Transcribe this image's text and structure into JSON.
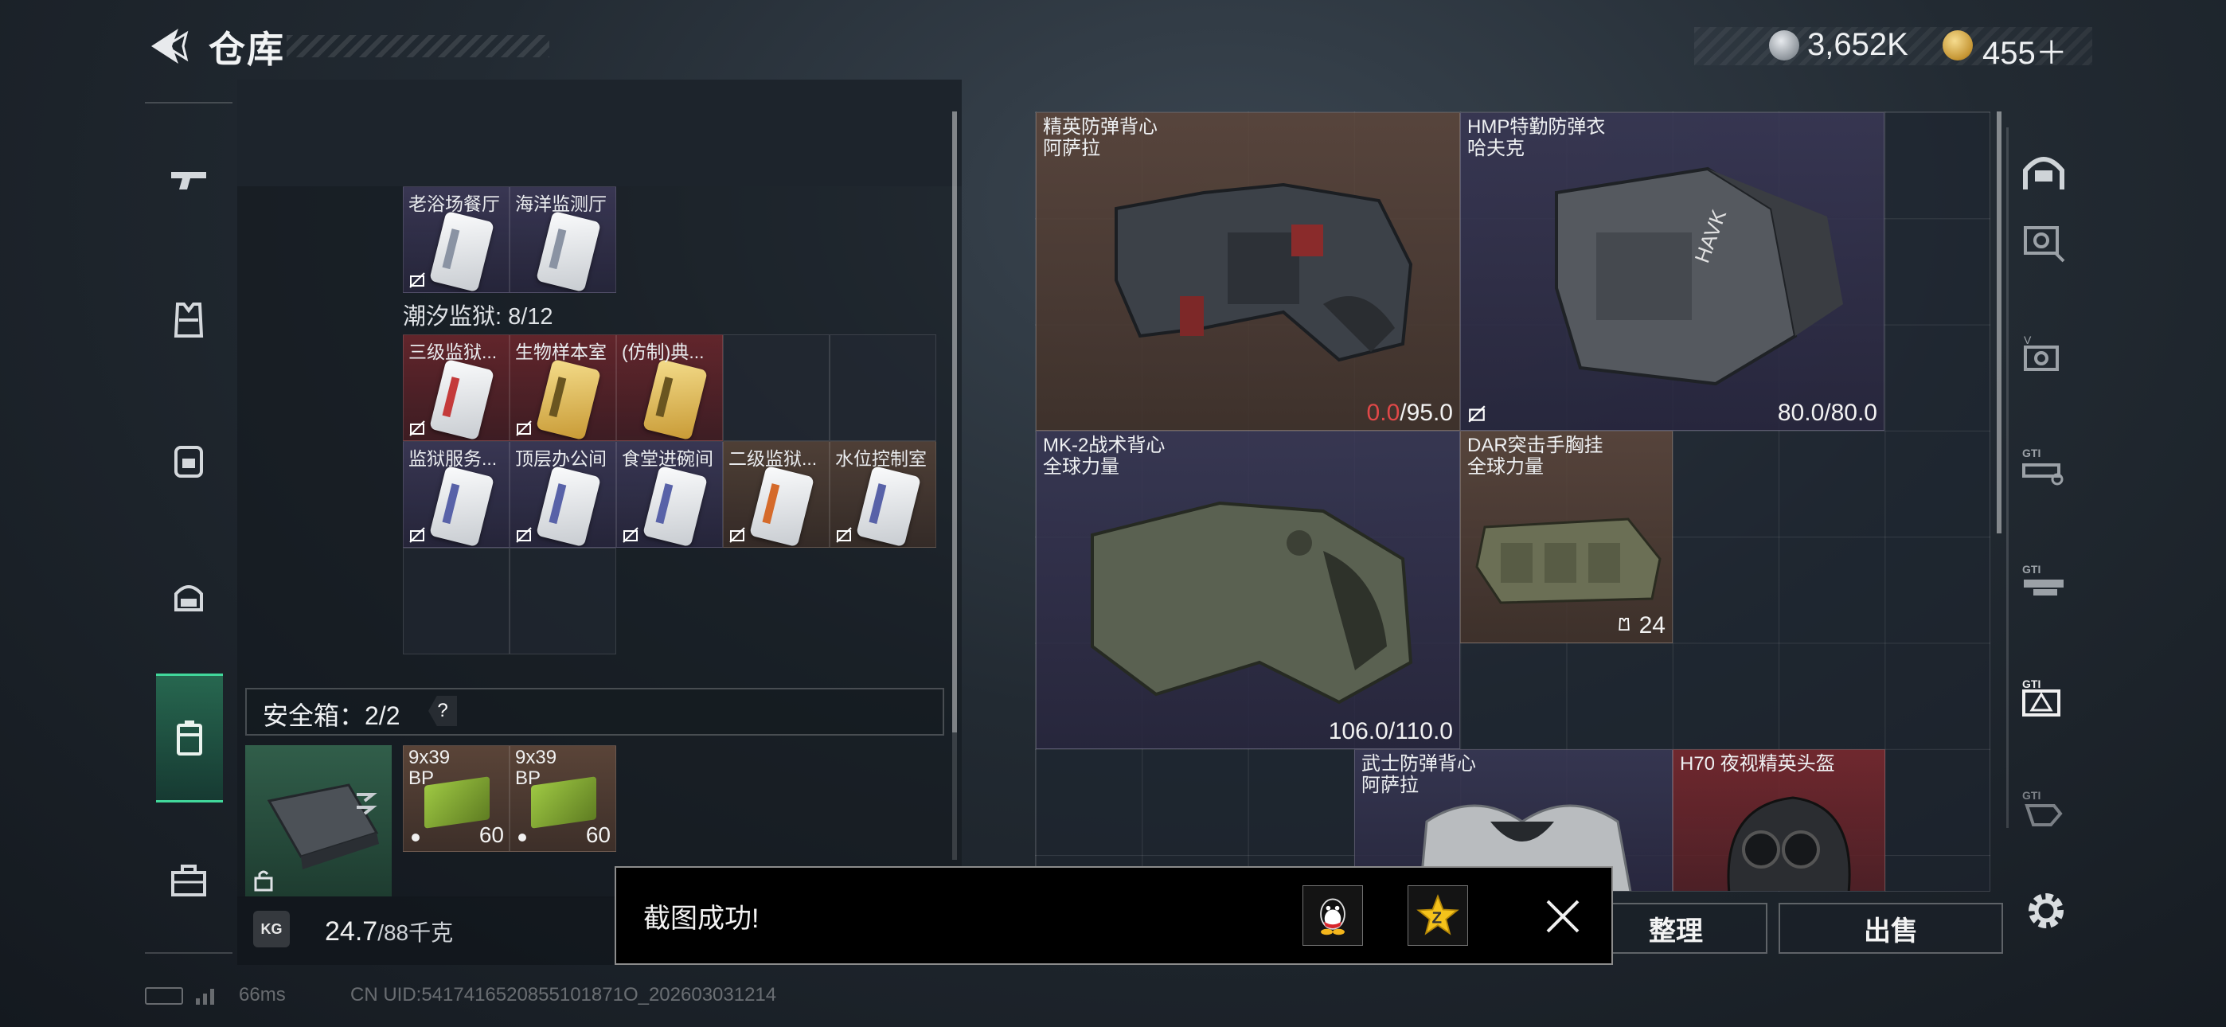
{
  "header": {
    "title": "仓库",
    "currency": [
      {
        "icon": "silver-coin-icon",
        "value": "3,652K"
      },
      {
        "icon": "gold-coin-icon",
        "value": "455＋"
      }
    ]
  },
  "left_nav": [
    {
      "icon": "pistol-icon"
    },
    {
      "icon": "armor-vest-icon"
    },
    {
      "icon": "backpack-icon"
    },
    {
      "icon": "helmet-bag-icon"
    },
    {
      "icon": "safe-case-icon",
      "active": true
    },
    {
      "icon": "briefcase-icon"
    }
  ],
  "stash": {
    "top_row_items": [
      "",
      "",
      "",
      ""
    ],
    "row2": [
      {
        "label": "老浴场餐厅",
        "color": "purple",
        "card": "silver",
        "locked": true
      },
      {
        "label": "海洋监测厅",
        "color": "purple",
        "card": "silver",
        "locked": false
      }
    ],
    "prison_title": "潮汐监狱: 8/12",
    "prison_row1": [
      {
        "label": "三级监狱...",
        "color": "red",
        "card": "red",
        "locked": true
      },
      {
        "label": "生物样本室",
        "color": "red",
        "card": "gold",
        "locked": true
      },
      {
        "label": "(仿制)典...",
        "color": "red",
        "card": "gold",
        "locked": false
      }
    ],
    "prison_row2": [
      {
        "label": "监狱服务...",
        "color": "purple",
        "card": "blue",
        "locked": true
      },
      {
        "label": "顶层办公间",
        "color": "purple",
        "card": "blue",
        "locked": true
      },
      {
        "label": "食堂进碗间",
        "color": "purple",
        "card": "blue",
        "locked": true
      },
      {
        "label": "二级监狱...",
        "color": "brown",
        "card": "orange",
        "locked": true
      },
      {
        "label": "水位控制室",
        "color": "brown",
        "card": "blue",
        "locked": true
      }
    ]
  },
  "safe_box": {
    "label": "安全箱：2/2",
    "help": "?",
    "ammo": [
      {
        "label": "9x39\nBP",
        "count": "60"
      },
      {
        "label": "9x39\nBP",
        "count": "60"
      }
    ]
  },
  "weight": {
    "icon_text": "KG",
    "current": "24.7",
    "max": "/88千克"
  },
  "equipment": [
    {
      "name": "精英防弹背心",
      "brand": "阿萨拉",
      "dur_current": "0.0",
      "dur_max": "/95.0",
      "color": "brown"
    },
    {
      "name": "HMP特勤防弹衣",
      "brand": "哈夫克",
      "dur_current": "80.0",
      "dur_max": "/80.0",
      "color": "purple"
    },
    {
      "name": "MK-2战术背心",
      "brand": "全球力量",
      "dur_current": "106.0",
      "dur_max": "/110.0",
      "color": "purple"
    },
    {
      "name": "DAR突击手胸挂",
      "brand": "全球力量",
      "capacity": "24",
      "color": "brown"
    },
    {
      "name": "武士防弹背心",
      "brand": "阿萨拉",
      "color": "purple"
    },
    {
      "name": "H70 夜视精英头盔",
      "brand": "",
      "color": "red"
    }
  ],
  "side_tabs": [
    "helmet-icon",
    "vest-filter-icon",
    "vest-v-filter-icon",
    "gti-weapon-icon",
    "gti-rifle-icon",
    "gti-warning-icon",
    "gti-hand-icon"
  ],
  "actions": {
    "sort": "整理",
    "sell": "出售"
  },
  "toast": {
    "message": "截图成功!",
    "share": [
      "qq-icon",
      "qzone-icon"
    ]
  },
  "status": {
    "ping": "66ms",
    "uid": "CN UID:5417416520855101871O_202603031214"
  },
  "colors": {
    "active_tab": "#41d89b",
    "durability_zero": "#e04848"
  }
}
